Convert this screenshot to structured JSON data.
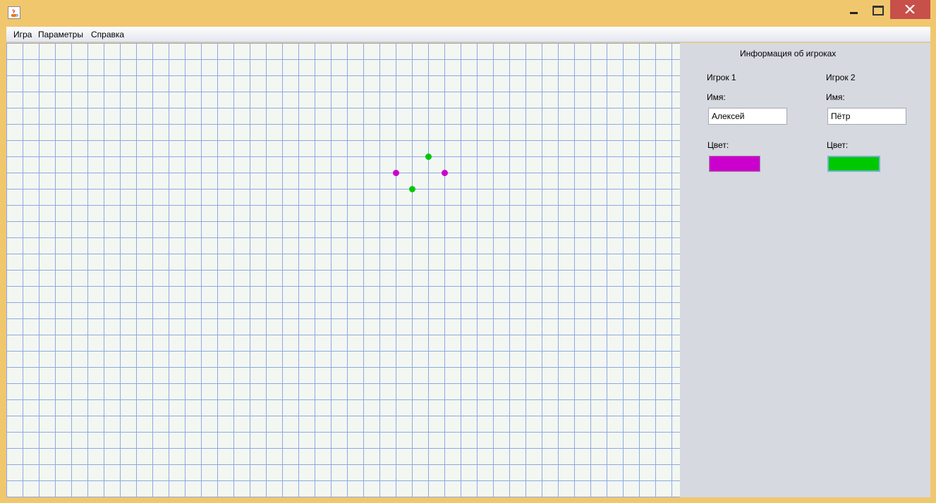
{
  "menubar": {
    "items": [
      {
        "label": "Игра"
      },
      {
        "label": "Параметры"
      },
      {
        "label": "Справка"
      }
    ]
  },
  "board": {
    "grid_color": "#8ea8e6",
    "background_color": "#f3f7f1",
    "points": [
      {
        "player": 2,
        "color": "#00c800"
      },
      {
        "player": 1,
        "color": "#cc00cc"
      },
      {
        "player": 1,
        "color": "#cc00cc"
      },
      {
        "player": 2,
        "color": "#00c800"
      }
    ]
  },
  "panel": {
    "title": "Информация об игроках",
    "players": [
      {
        "header": "Игрок 1",
        "name_label": "Имя:",
        "name_value": "Алексей",
        "color_label": "Цвет:",
        "color": "#cc00cc"
      },
      {
        "header": "Игрок 2",
        "name_label": "Имя:",
        "name_value": "Пётр",
        "color_label": "Цвет:",
        "color": "#00c800"
      }
    ]
  },
  "window": {
    "icon": "java-cup-icon",
    "controls": [
      "minimize-icon",
      "maximize-icon",
      "close-icon"
    ]
  }
}
